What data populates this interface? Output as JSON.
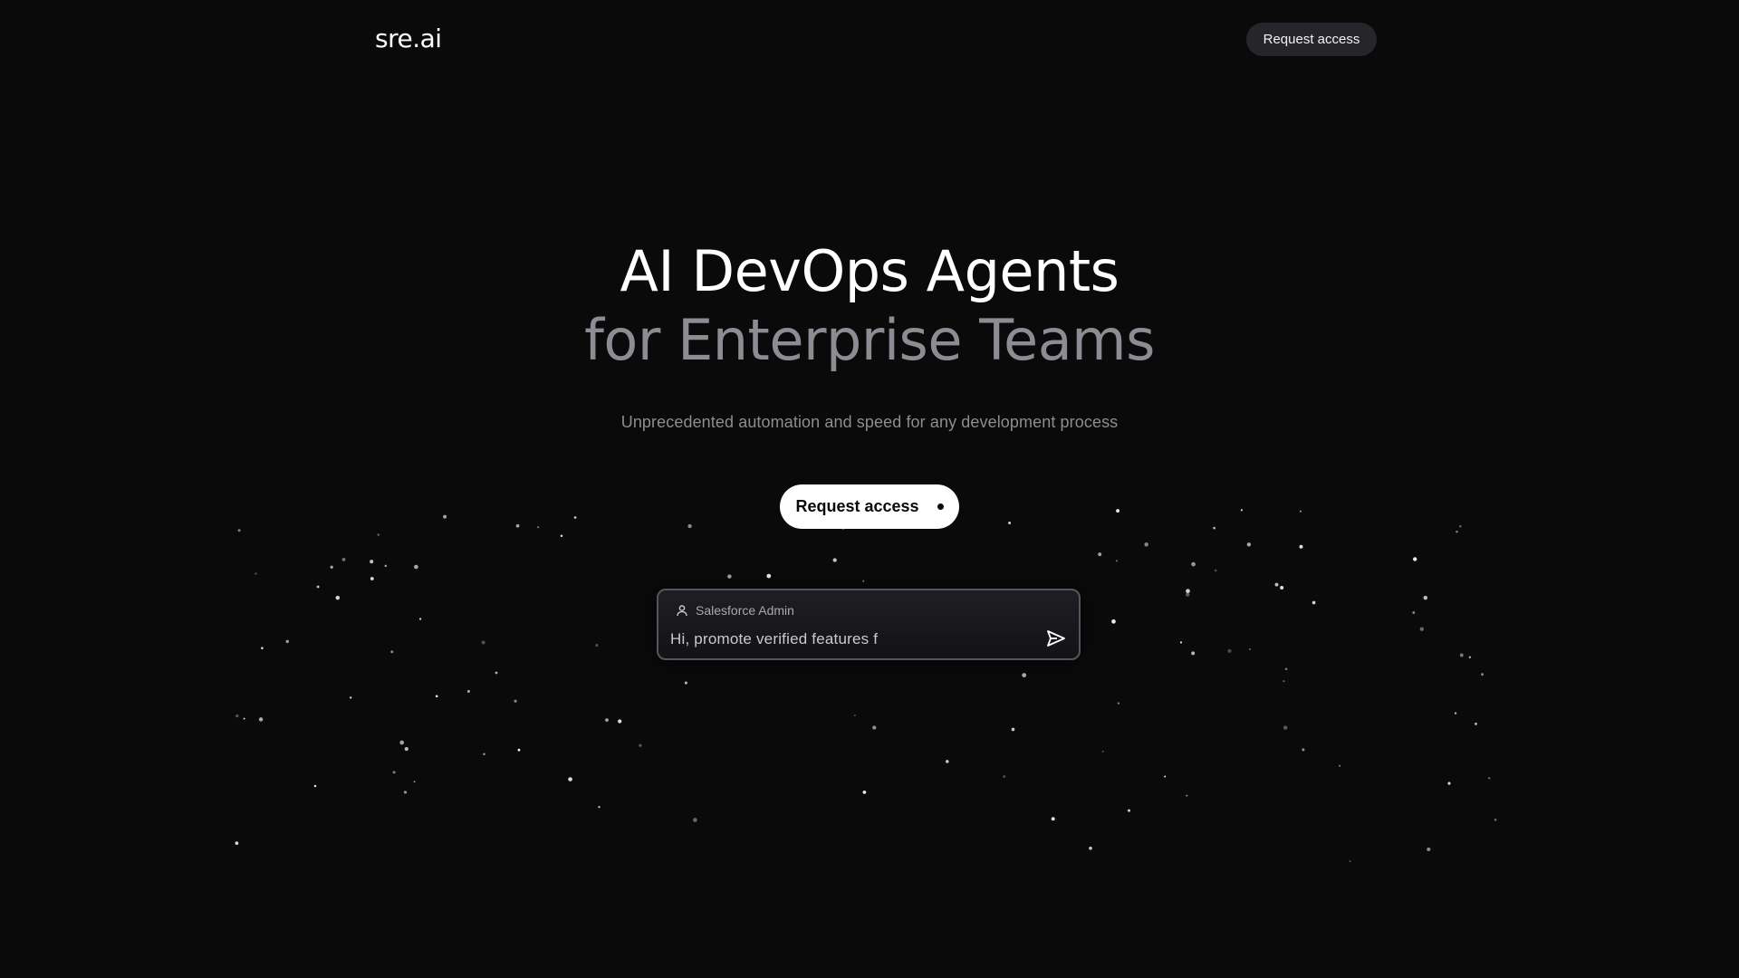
{
  "header": {
    "logo": "sre.ai",
    "request_access_label": "Request access"
  },
  "hero": {
    "title_line1": "AI DevOps Agents",
    "title_line2": "for Enterprise Teams",
    "subtitle": "Unprecedented automation and speed for any development process",
    "cta_label": "Request access"
  },
  "chat": {
    "user_role": "Salesforce Admin",
    "message": "Hi, promote verified features f",
    "user_icon": "user-icon",
    "send_icon": "send-icon"
  },
  "colors": {
    "background": "#0a0a0a",
    "title_primary": "#ffffff",
    "title_secondary": "#8c8d92",
    "header_button": "#26262a",
    "cta_background": "#ffffff"
  }
}
